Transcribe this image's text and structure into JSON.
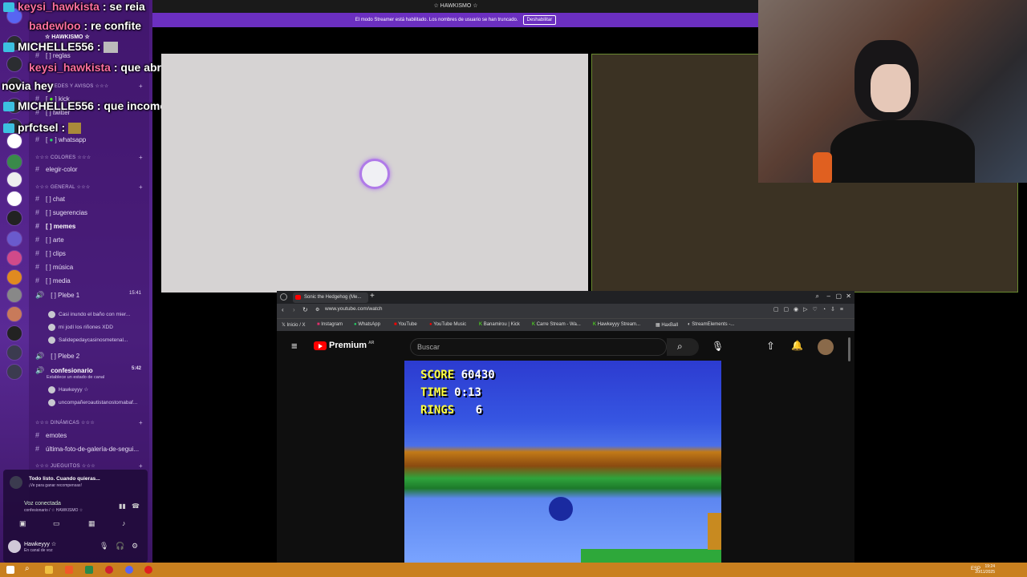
{
  "chat": [
    {
      "name": "keysi_hawkista",
      "message": ": se reia"
    },
    {
      "name": "badewloo",
      "message": ": re confite"
    },
    {
      "name": "MICHELLE556",
      "message": ":"
    },
    {
      "name": "keysi_hawkista",
      "message": ": que abrazas duki tienes"
    },
    {
      "name": "novia hey",
      "message": ""
    },
    {
      "name": "MICHELLE556",
      "message": ": que incomodo"
    },
    {
      "name": "prfctsel",
      "message": ":"
    }
  ],
  "discord": {
    "server_name": "☆ HAWKISMO ☆",
    "categories": {
      "redes": "☆☆☆ REDES Y AVISOS ☆☆☆",
      "colores": "☆☆☆ COLORES ☆☆☆",
      "general": "☆☆☆ GENERAL ☆☆☆",
      "dinamicas": "☆☆☆ DINÁMICAS ☆☆☆",
      "juegos": "☆☆☆ JUEGUITOS ☆☆☆"
    },
    "channels": {
      "reglas": "reglas",
      "kick": "kick",
      "twitter": "twitter",
      "whatsapp": "whatsapp",
      "elegir_color": "elegir-color",
      "chat": "chat",
      "sugerencias": "sugerencias",
      "memes": "memes",
      "arte": "arte",
      "clips": "clips",
      "musica": "música",
      "media": "media",
      "plebe1": "Plebe 1",
      "plebe1_time": "15:41",
      "plebe2": "Plebe 2",
      "confesionario": "confesionario",
      "confesionario_time": "5:42",
      "confesionario_sub": "Establece un estado de canal",
      "emotes": "emotes",
      "ultima_foto": "última-foto-de-galería-de-segui..."
    },
    "voice_users_plebe1": [
      "Casi inundo el baño con mier...",
      "mi jodí los riñones XDD",
      "Salidepedaycasinosmetenal..."
    ],
    "voice_users_confesionario": [
      "Hawkeyyy ☆",
      "uncompañeroautistanostomabaf..."
    ],
    "notification": {
      "title": "Todo listo. Cuando quieras...",
      "subtitle": "¡Ve para ganar recompensas!"
    },
    "voice": {
      "status": "Voz conectada",
      "channel": "confesionario / ☆ HAWKISMO ☆"
    },
    "user": {
      "name": "Hawkeyyy ☆",
      "status": "En canal de voz"
    }
  },
  "topbar": {
    "title": "☆ HAWKISMO ☆",
    "streamer_notice": "El modo Streamer está habilitado. Los nombres de usuario se han truncado.",
    "disable_label": "Deshabilitar"
  },
  "browser": {
    "tab_title": "Sonic the Hedgehog (Me...",
    "url": "www.youtube.com/watch",
    "bookmarks": [
      "Inicio / X",
      "Instagram",
      "WhatsApp",
      "YouTube",
      "YouTube Music",
      "Banamirou | Kick",
      "Carre Stream - Wa...",
      "Hawkeyyy Stream...",
      "HaxBall",
      "StreamElements -..."
    ],
    "yt_logo": "Premium",
    "yt_region": "AR",
    "search_placeholder": "Buscar"
  },
  "game": {
    "score_label": "SCORE",
    "score": "60430",
    "time_label": "TIME",
    "time": "0:13",
    "rings_label": "RINGS",
    "rings": "6"
  },
  "taskbar": {
    "time": "19:24",
    "date": "20/11/2025",
    "lang": "ESP"
  }
}
